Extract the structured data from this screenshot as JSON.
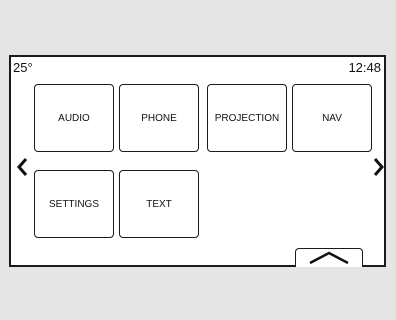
{
  "status": {
    "temperature": "25°",
    "clock": "12:48"
  },
  "tiles": [
    {
      "label": "AUDIO"
    },
    {
      "label": "PHONE"
    },
    {
      "label": "PROJECTION"
    },
    {
      "label": "NAV"
    },
    {
      "label": "SETTINGS"
    },
    {
      "label": "TEXT"
    }
  ],
  "icons": {
    "left": "chevron-left-icon",
    "right": "chevron-right-icon",
    "up": "chevron-up-icon"
  }
}
